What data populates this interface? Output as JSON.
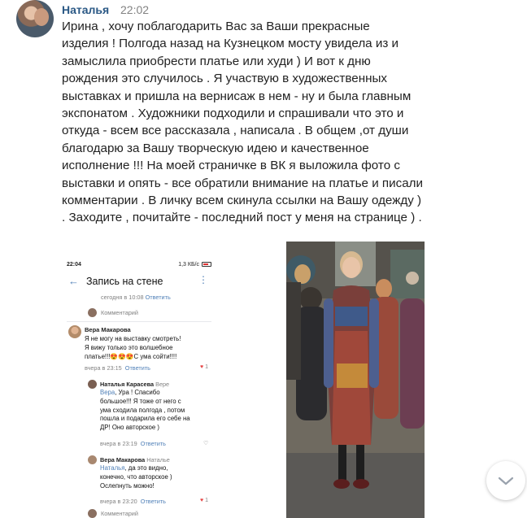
{
  "message": {
    "author": "Наталья",
    "time": "22:02",
    "lines": [
      "Ирина , хочу поблагодарить Вас за Ваши прекрасные",
      "изделия ! Полгода назад на Кузнецком мосту увидела из и",
      "замыслила приобрести платье или худи ) И вот к дню",
      "рождения это случилось . Я участвую в художественных",
      "выставках и пришла на вернисаж в нем - ну и была главным",
      "экспонатом . Художники подходили и спрашивали что это и",
      "откуда - всем все рассказала , написала . В общем ,от души",
      "благодарю за Вашу творческую идею и качественное",
      "исполнение !!! На моей страничке в ВК я выложила фото с",
      "выставки и опять - все обратили внимание на платье и писали",
      "комментарии . В личку всем скинула ссылки на Вашу одежду )",
      ". Заходите , почитайте - последний пост у меня на странице ) ."
    ]
  },
  "phone": {
    "status_time": "22:04",
    "status_right": "1,3 КБ/с",
    "header_title": "Запись на стене",
    "top_meta_time": "сегодня в 10:08",
    "top_meta_reply": "Ответить",
    "comment_input_1": "Комментарий",
    "c1_name": "Вера Макарова",
    "c1_lines": [
      "Я не могу на выставку смотреть!",
      "Я вижу только это волшебное",
      "платье!!!😍😍😍С ума сойти!!!!"
    ],
    "c1_time": "вчера в 23:15",
    "c1_reply": "Ответить",
    "c1_likes": "1",
    "c2_name": "Наталья Карасева",
    "c2_to": "Вере",
    "c2_link": "Вера",
    "c2_lines": [
      ", Ура ! Спасибо",
      "большое!!! Я тоже от него с",
      "ума сходила полгода , потом",
      "пошла и подарила его себе на",
      "ДР! Оно авторское )"
    ],
    "c2_time": "вчера в 23:19",
    "c2_reply": "Ответить",
    "c3_name": "Вера Макарова",
    "c3_to": "Наталье",
    "c3_link": "Наталья",
    "c3_lines": [
      ", да это видно,",
      "конечно, что авторское )",
      "Ослепнуть можно!"
    ],
    "c3_time": "вчера в 23:20",
    "c3_reply": "Ответить",
    "c3_likes": "1",
    "comment_input_2": "Комментарий"
  },
  "colors": {
    "link": "#2a5885",
    "accent": "#5181b8",
    "heart": "#e64646"
  },
  "icons": {
    "scroll": "chevron-down-icon",
    "back": "arrow-left-icon",
    "menu": "kebab-menu-icon",
    "like": "heart-icon"
  }
}
